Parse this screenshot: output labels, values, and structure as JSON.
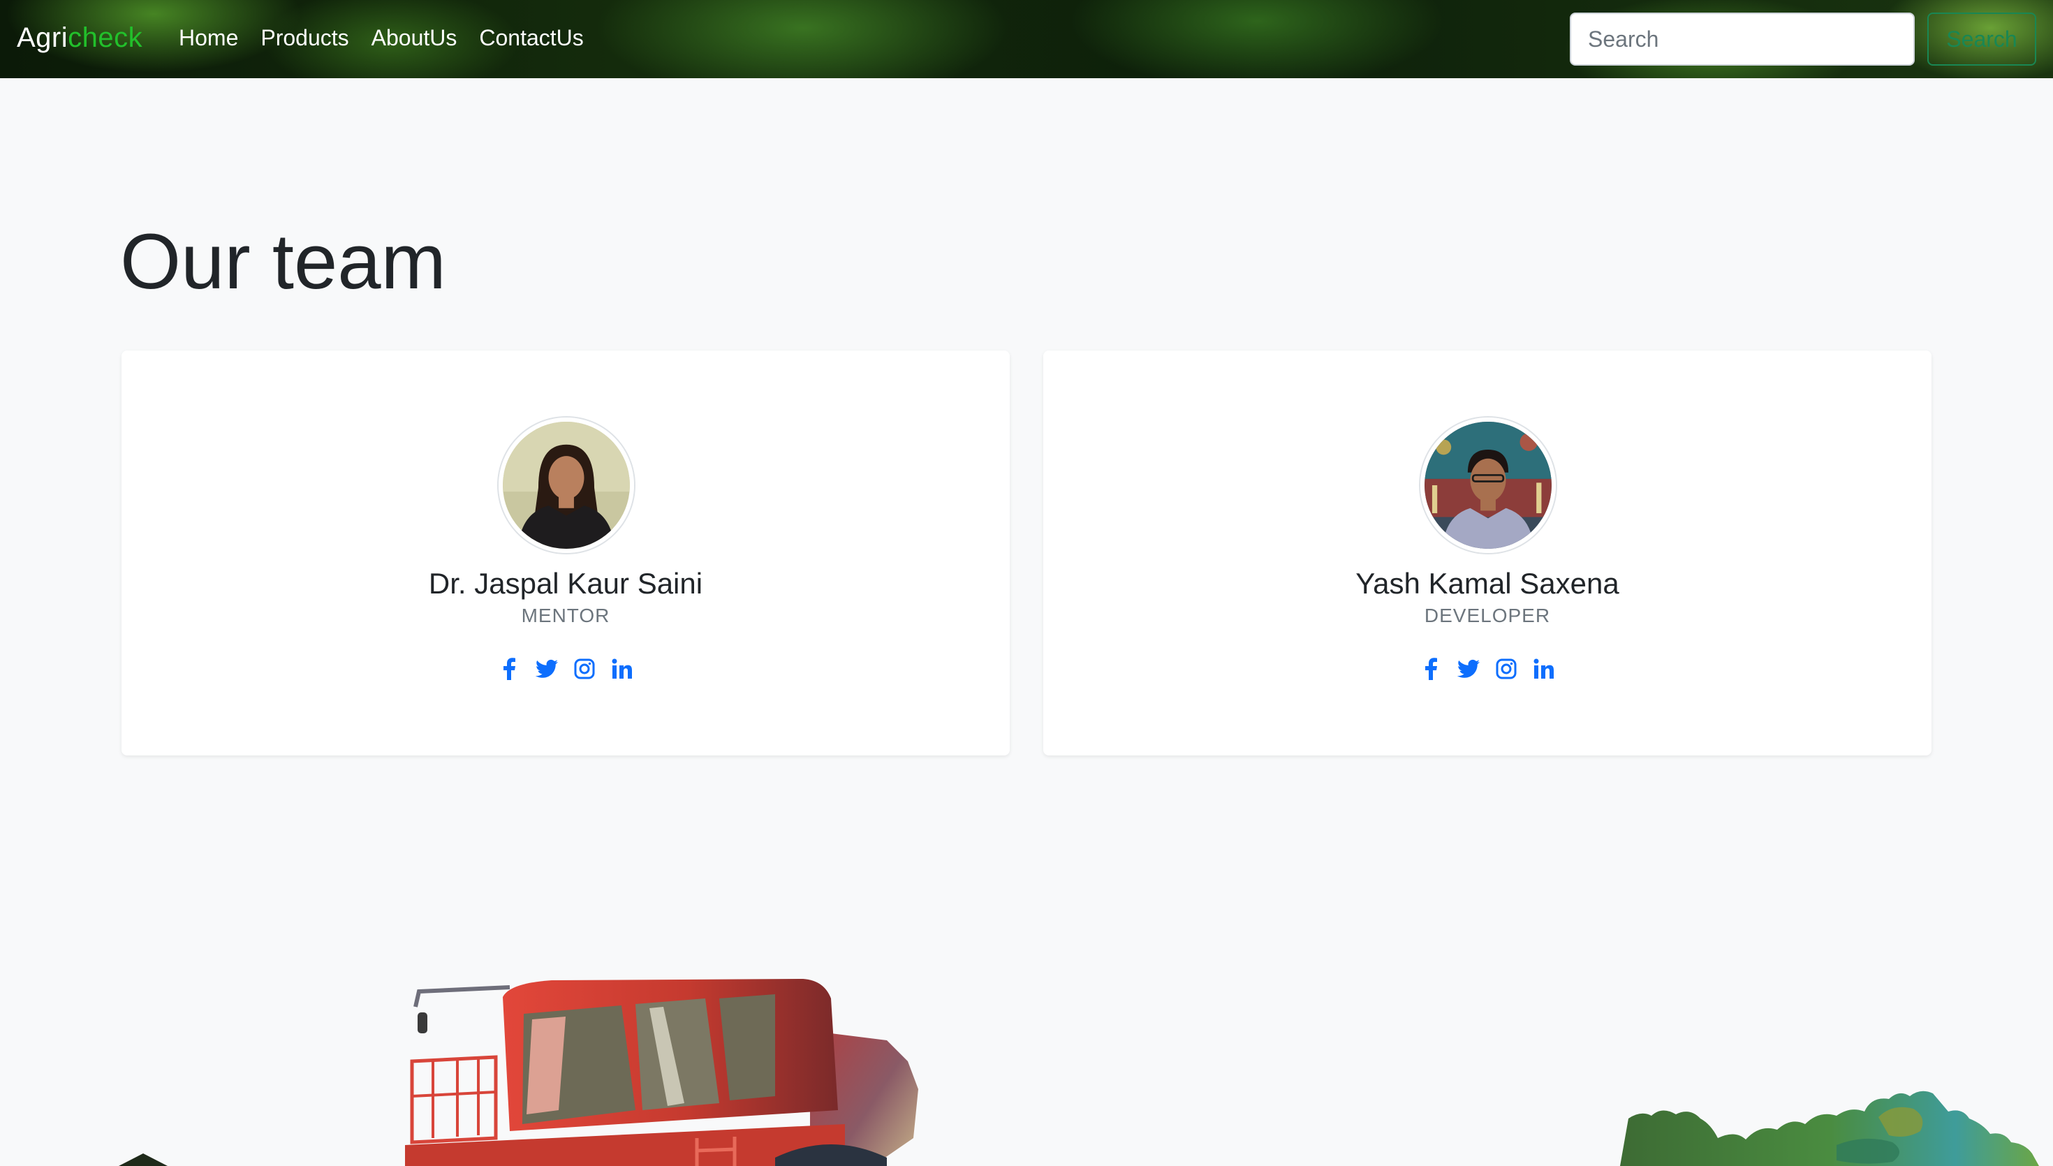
{
  "navbar": {
    "brand_prefix": "Agri",
    "brand_accent": "check",
    "links": [
      "Home",
      "Products",
      "AboutUs",
      "ContactUs"
    ],
    "search_placeholder": "Search",
    "search_button": "Search"
  },
  "section": {
    "title": "Our team"
  },
  "team": [
    {
      "name": "Dr. Jaspal Kaur Saini",
      "role": "MENTOR",
      "socials": [
        "facebook-icon",
        "twitter-icon",
        "instagram-icon",
        "linkedin-icon"
      ]
    },
    {
      "name": "Yash Kamal Saxena",
      "role": "DEVELOPER",
      "socials": [
        "facebook-icon",
        "twitter-icon",
        "instagram-icon",
        "linkedin-icon"
      ]
    }
  ],
  "colors": {
    "brand_accent": "#22c02b",
    "search_button": "#198754",
    "social_icons": "#0d6efd",
    "page_background": "#f8f9fa"
  }
}
